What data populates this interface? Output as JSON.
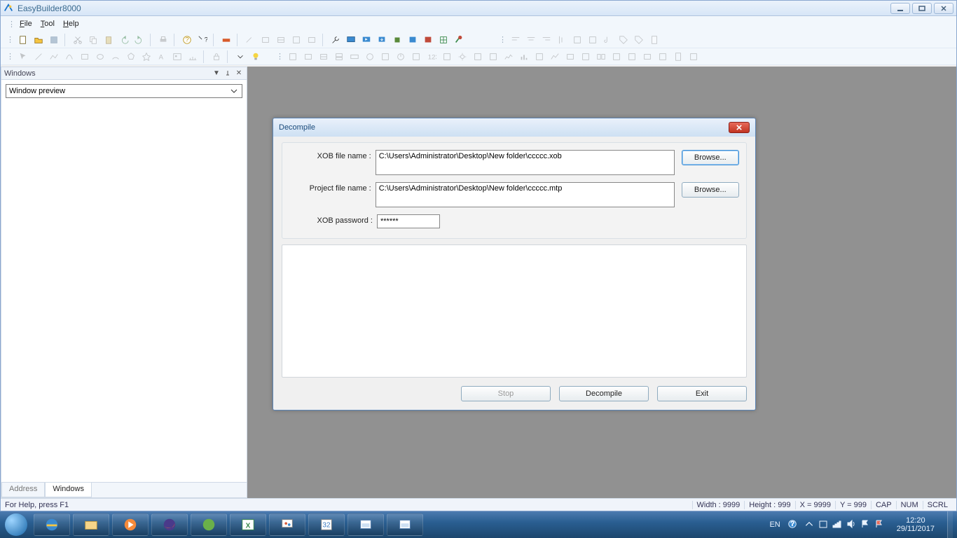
{
  "app": {
    "title": "EasyBuilder8000"
  },
  "menu": {
    "file": "File",
    "tool": "Tool",
    "help": "Help"
  },
  "panel": {
    "title": "Windows",
    "combo_value": "Window preview",
    "tab_address": "Address",
    "tab_windows": "Windows"
  },
  "status": {
    "help": "For Help, press F1",
    "width": "Width : 9999",
    "height": "Height : 999",
    "x": "X = 9999",
    "y": "Y = 999",
    "cap": "CAP",
    "num": "NUM",
    "scrl": "SCRL"
  },
  "dialog": {
    "title": "Decompile",
    "lbl_xob": "XOB file name :",
    "val_xob": "C:\\Users\\Administrator\\Desktop\\New folder\\ccccc.xob",
    "lbl_proj": "Project file name :",
    "val_proj": "C:\\Users\\Administrator\\Desktop\\New folder\\ccccc.mtp",
    "lbl_pwd": "XOB password :",
    "val_pwd": "******",
    "browse": "Browse...",
    "btn_stop": "Stop",
    "btn_decompile": "Decompile",
    "btn_exit": "Exit"
  },
  "systray": {
    "lang": "EN",
    "time": "12:20",
    "date": "29/11/2017"
  }
}
